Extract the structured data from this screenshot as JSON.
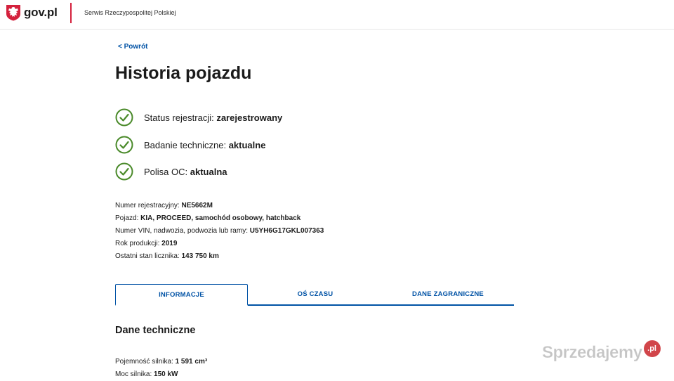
{
  "header": {
    "logo_text": "gov.pl",
    "service_name": "Serwis Rzeczypospolitej Polskiej",
    "accent_color": "#d4213d"
  },
  "nav": {
    "back_label": "< Powrót"
  },
  "page": {
    "title": "Historia pojazdu"
  },
  "statuses": [
    {
      "label": "Status rejestracji: ",
      "value": "zarejestrowany",
      "icon": "check-circle-icon"
    },
    {
      "label": "Badanie techniczne: ",
      "value": "aktualne",
      "icon": "check-circle-icon"
    },
    {
      "label": "Polisa OC: ",
      "value": "aktualna",
      "icon": "check-circle-icon"
    }
  ],
  "status_color": "#4a8a2a",
  "vehicle": [
    {
      "label": "Numer rejestracyjny: ",
      "value": "NE5662M"
    },
    {
      "label": "Pojazd: ",
      "value": "KIA, PROCEED, samochód osobowy, hatchback"
    },
    {
      "label": "Numer VIN, nadwozia, podwozia lub ramy: ",
      "value": "U5YH6G17GKL007363"
    },
    {
      "label": "Rok produkcji: ",
      "value": "2019"
    },
    {
      "label": "Ostatni stan licznika: ",
      "value": "143 750 km"
    }
  ],
  "tabs": [
    {
      "label": "INFORMACJE",
      "active": true
    },
    {
      "label": "OŚ CZASU",
      "active": false
    },
    {
      "label": "DANE ZAGRANICZNE",
      "active": false
    }
  ],
  "tab_color": "#0052a5",
  "technical": {
    "heading": "Dane techniczne",
    "items": [
      {
        "label": "Pojemność silnika: ",
        "value": "1 591 cm³"
      },
      {
        "label": "Moc silnika: ",
        "value": "150 kW"
      }
    ]
  },
  "watermark": {
    "text": "Sprzedajemy",
    "badge": ".pl"
  }
}
